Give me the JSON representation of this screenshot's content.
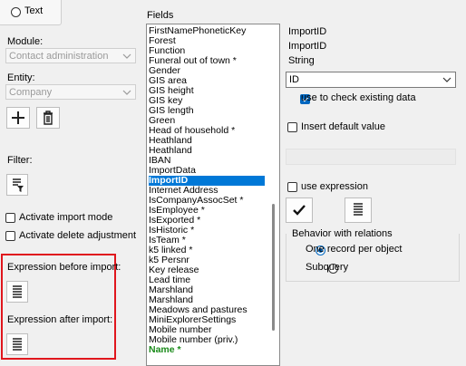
{
  "left": {
    "text_option": "Text",
    "module_label": "Module:",
    "module_value": "Contact administration",
    "entity_label": "Entity:",
    "entity_value": "Company",
    "filter_label": "Filter:",
    "activate_import_mode": "Activate import mode",
    "activate_delete_adjustment": "Activate delete adjustment",
    "expression_before": "Expression before import:",
    "expression_after": "Expression after import:"
  },
  "fields": {
    "heading": "Fields",
    "items": [
      "FirstNamePhoneticKey",
      "Forest",
      "Function",
      "Funeral out of town *",
      "Gender",
      "GIS area",
      "GIS height",
      "GIS key",
      "GIS length",
      "Green",
      "Head of household *",
      "Heathland",
      "Heathland",
      "IBAN",
      "ImportData",
      "ImportID",
      "Internet Address",
      "IsCompanyAssocSet *",
      "IsEmployee *",
      "IsExported *",
      "IsHistoric *",
      "IsTeam *",
      "k5 linked *",
      "k5 Persnr",
      "Key release",
      "Lead time",
      "Marshland",
      "Marshland",
      "Meadows and pastures",
      "MiniExplorerSettings",
      "Mobile number",
      "Mobile number (priv.)",
      "Name *"
    ],
    "selected_index": 15,
    "green_index": 32
  },
  "right": {
    "field_name": "ImportID",
    "field_caption": "ImportID",
    "field_type": "String",
    "key_value": "ID",
    "use_to_check": "use to check existing data",
    "insert_default": "Insert default value",
    "use_expression": "use expression",
    "behavior_heading": "Behavior with relations",
    "one_record": "One record per object",
    "subquery": "Subquery"
  },
  "colors": {
    "highlight_box": "#e0161d",
    "selection": "#0078d7",
    "accent": "#0067c0"
  }
}
